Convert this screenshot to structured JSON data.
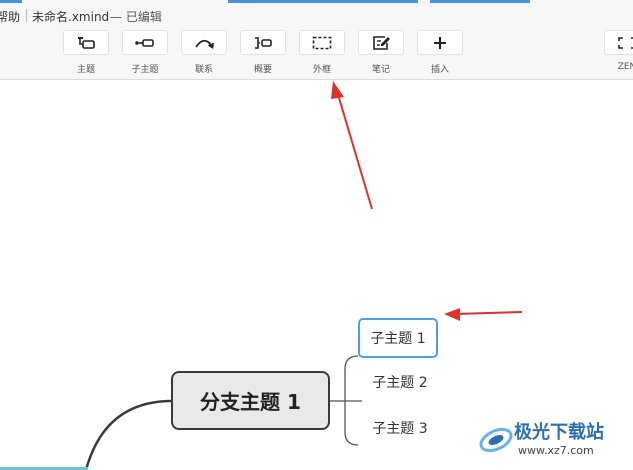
{
  "titlebar": {
    "menu_help": "帮助",
    "filename": "未命名.xmind",
    "status": "— 已编辑"
  },
  "toolbar": {
    "items": [
      {
        "label": "主题",
        "icon": "topic-icon"
      },
      {
        "label": "子主题",
        "icon": "subtopic-icon"
      },
      {
        "label": "联系",
        "icon": "relationship-icon"
      },
      {
        "label": "概要",
        "icon": "summary-icon"
      },
      {
        "label": "外框",
        "icon": "boundary-icon"
      },
      {
        "label": "笔记",
        "icon": "note-icon"
      },
      {
        "label": "插入",
        "icon": "plus-icon"
      },
      {
        "label": "ZEN",
        "icon": "zen-mode-icon"
      }
    ]
  },
  "mindmap": {
    "branch": "分支主题 1",
    "subtopics": [
      "子主题 1",
      "子主题 2",
      "子主题 3"
    ],
    "selected_index": 0
  },
  "colors": {
    "accent_blue": "#4aa3df",
    "annotation_red": "#e0302a",
    "line": "#3a3a3a"
  },
  "watermark": {
    "text": "极光下载站",
    "url": "www.xz7.com"
  }
}
